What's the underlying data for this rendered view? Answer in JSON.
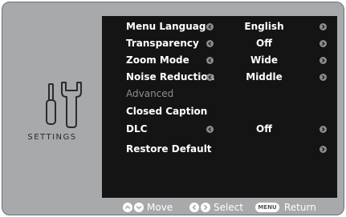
{
  "sidebar": {
    "title": "SETTINGS",
    "icon": "tools-icon"
  },
  "menu": {
    "rows": [
      {
        "label": "Menu Language",
        "value": "English"
      },
      {
        "label": "Transparency",
        "value": "Off"
      },
      {
        "label": "Zoom Mode",
        "value": "Wide"
      },
      {
        "label": "Noise Reduction",
        "value": "Middle"
      },
      {
        "label": "Advanced",
        "disabled": true
      },
      {
        "label": "Closed Caption"
      },
      {
        "label": "DLC",
        "value": "Off"
      },
      {
        "label": "Restore Default"
      }
    ]
  },
  "footer": {
    "move_label": "Move",
    "select_label": "Select",
    "menu_key": "MENU",
    "return_label": "Return"
  },
  "colors": {
    "frame": "#a8a9ab",
    "menu_bg": "#141414",
    "arrow": "#8c8c8c",
    "disabled": "#8e8e8e"
  }
}
